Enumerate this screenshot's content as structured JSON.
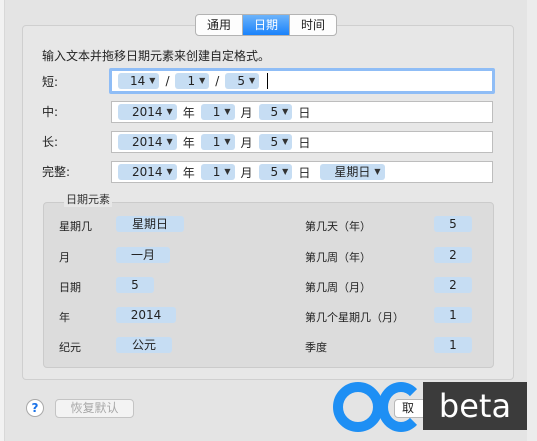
{
  "tabs": [
    "通用",
    "日期",
    "时间"
  ],
  "instruction": "输入文本并拖移日期元素来创建自定格式。",
  "rows": [
    {
      "label": "短:",
      "tokens": [
        "14",
        "1",
        "5"
      ],
      "separators": [
        "/",
        "/"
      ]
    },
    {
      "label": "中:",
      "tokens": [
        "2014",
        "1",
        "5"
      ],
      "literals": [
        "年",
        "月",
        "日"
      ]
    },
    {
      "label": "长:",
      "tokens": [
        "2014",
        "1",
        "5"
      ],
      "literals": [
        "年",
        "月",
        "日"
      ]
    },
    {
      "label": "完整:",
      "tokens": [
        "2014",
        "1",
        "5",
        "星期日"
      ],
      "literals": [
        "年",
        "月",
        "日"
      ]
    }
  ],
  "elements": {
    "title": "日期元素",
    "left": [
      {
        "label": "星期几",
        "value": "星期日"
      },
      {
        "label": "月",
        "value": "一月"
      },
      {
        "label": "日期",
        "value": "5"
      },
      {
        "label": "年",
        "value": "2014"
      },
      {
        "label": "纪元",
        "value": "公元"
      }
    ],
    "right": [
      {
        "label": "第几天（年）",
        "value": "5"
      },
      {
        "label": "第几周（年）",
        "value": "2"
      },
      {
        "label": "第几周（月）",
        "value": "2"
      },
      {
        "label": "第几个星期几（月）",
        "value": "1"
      },
      {
        "label": "季度",
        "value": "1"
      }
    ]
  },
  "buttons": {
    "help": "?",
    "restore": "恢复默认",
    "cancel": "取"
  },
  "watermark": {
    "text": "beta"
  },
  "colors": {
    "accent": "#1a82fb",
    "token": "#c6ddf3",
    "watermark_blue": "#1e8ff4"
  }
}
